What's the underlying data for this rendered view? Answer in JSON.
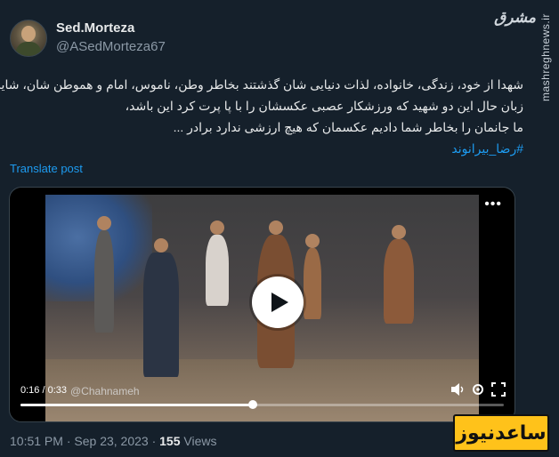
{
  "author": {
    "display_name": "Sed.Morteza",
    "handle": "@ASedMorteza67"
  },
  "watermark": {
    "side_text": "mashreghnews.ir",
    "logo_text": "مشرق"
  },
  "tweet": {
    "lines": [
      "شهدا از خود، زندگی، خانواده، لذات دنیایی شان گذشتند بخاطر وطن، ناموس، امام و هموطن شان، شاید",
      "زبان حال این دو شهید که ورزشکار عصبی عکسشان را با پا پرت کرد این باشد،",
      "ما جانمان را بخاطر شما دادیم عکسمان که هیچ ارزشی ندارد برادر ..."
    ],
    "hashtag": "#رضا_بیرانوند",
    "translate_label": "Translate post"
  },
  "video": {
    "time_readout": "0:16 / 0:33",
    "watermark": "@Chahnameh",
    "more_label": "•••",
    "progress_fraction": 0.48
  },
  "meta": {
    "time": "10:51 PM",
    "separator": "·",
    "date": "Sep 23, 2023",
    "views_count": "155",
    "views_label": "Views"
  },
  "badge": {
    "text": "ساعدنیوز"
  },
  "colors": {
    "background": "#15202b",
    "accent": "#1d9bf0",
    "muted": "#8b98a5",
    "badge": "#ffc21a"
  },
  "icons": [
    "play-icon",
    "more-icon",
    "volume-icon",
    "settings-icon",
    "fullscreen-icon"
  ]
}
